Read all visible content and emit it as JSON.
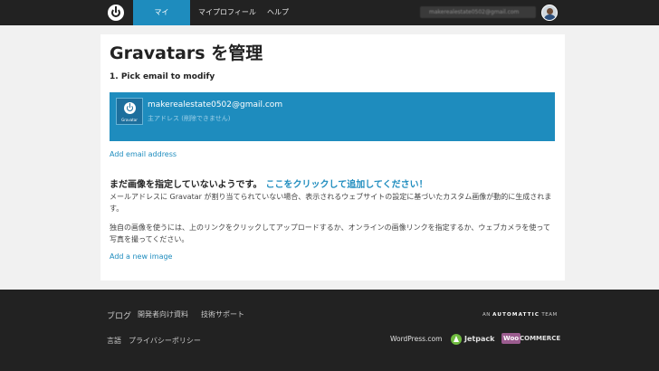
{
  "header": {
    "nav": [
      "マイ Gravatar",
      "マイプロフィール",
      "ヘルプ"
    ],
    "account_email": "makerealestate0502@gmail.com"
  },
  "main": {
    "title": "Gravatars を管理",
    "pick_heading": "1. Pick email to modify",
    "email": {
      "address": "makerealestate0502@gmail.com",
      "note": "主アドレス (削除できません)",
      "avatar_caption": "Gravatar"
    },
    "add_email": "Add email address",
    "no_image_heading": "まだ画像を指定していないようです。",
    "no_image_link": "ここをクリックして追加してください！",
    "paragraph1": "メールアドレスに Gravatar が割り当てられていない場合、表示されるウェブサイトの設定に基づいたカスタム画像が動的に生成されます。",
    "paragraph2": "独自の画像を使うには、上のリンクをクリックしてアップロードするか、オンラインの画像リンクを指定するか、ウェブカメラを使って写真を撮ってください。",
    "add_image": "Add a new image"
  },
  "footer": {
    "row1": [
      "ブログ",
      "開発者向け資料",
      "技術サポート"
    ],
    "row2": [
      "言語",
      "プライバシーポリシー"
    ],
    "automattic_prefix": "AN",
    "automattic_name": "AUTOMATTIC",
    "automattic_suffix": "TEAM",
    "brands": {
      "wordpress": "WordPress.com",
      "jetpack": "Jetpack",
      "woo": "Woo",
      "commerce": "COMMERCE"
    }
  },
  "colors": {
    "accent": "#1e8cbe",
    "bar": "#222222"
  }
}
